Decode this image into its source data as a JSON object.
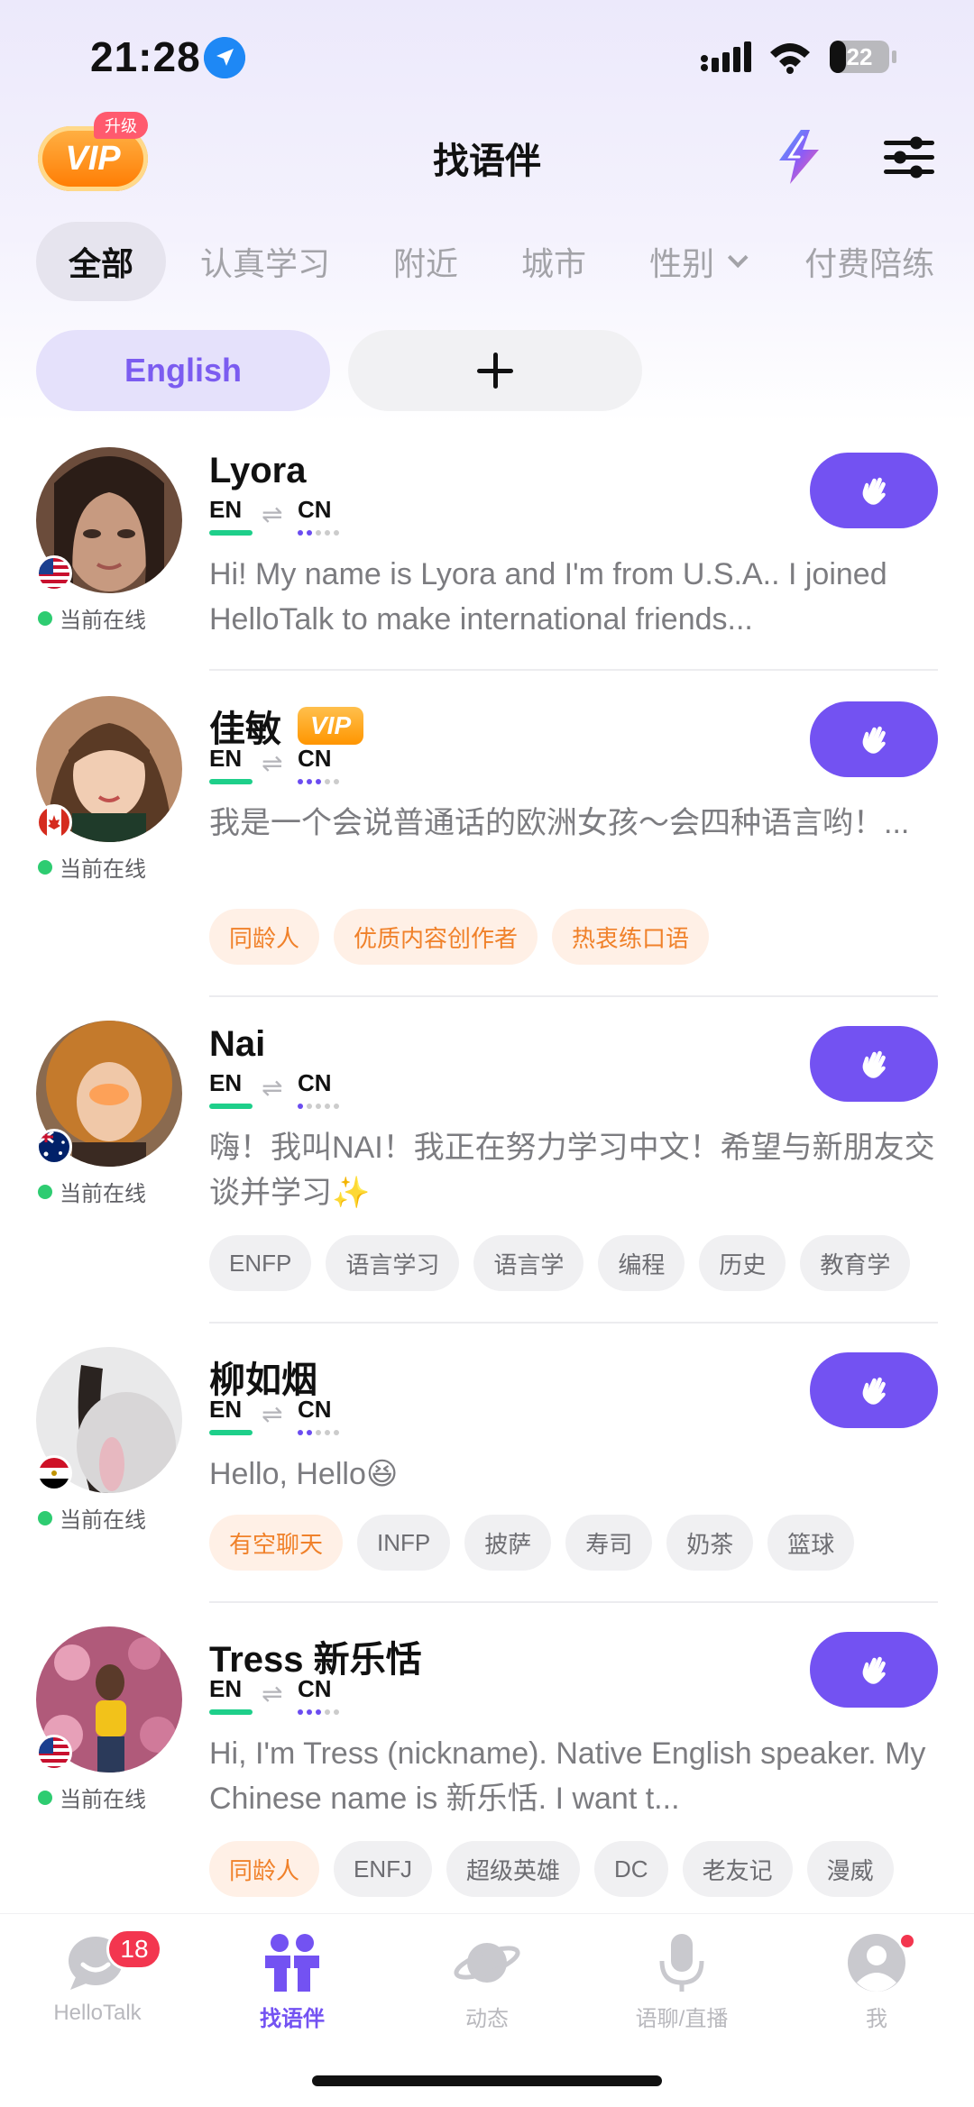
{
  "status_bar": {
    "time": "21:28",
    "battery": "22"
  },
  "header": {
    "title": "找语伴",
    "vip_label": "VIP",
    "upgrade_label": "升级"
  },
  "category_tabs": [
    {
      "label": "全部",
      "active": true
    },
    {
      "label": "认真学习"
    },
    {
      "label": "附近"
    },
    {
      "label": "城市"
    },
    {
      "label": "性别",
      "dropdown": true
    },
    {
      "label": "付费陪练"
    }
  ],
  "language_filter": {
    "selected": "English",
    "add_symbol": "+"
  },
  "users": [
    {
      "name": "Lyora",
      "vip": false,
      "native": "EN",
      "learning": "CN",
      "learning_level": 2,
      "flag": "us-flag",
      "status": "当前在线",
      "bio": "Hi! My name is Lyora and I'm from U.S.A.. I joined HelloTalk to make international friends...",
      "tags": []
    },
    {
      "name": "佳敏",
      "vip": true,
      "vip_label": "VIP",
      "native": "EN",
      "learning": "CN",
      "learning_level": 3,
      "flag": "ca-flag",
      "status": "当前在线",
      "bio": "我是一个会说普通话的欧洲女孩～会四种语言哟！...",
      "tags": [
        {
          "label": "同龄人",
          "highlight": true
        },
        {
          "label": "优质内容创作者",
          "highlight": true
        },
        {
          "label": "热衷练口语",
          "highlight": true
        }
      ]
    },
    {
      "name": "Nai",
      "vip": false,
      "native": "EN",
      "learning": "CN",
      "learning_level": 1,
      "flag": "au-flag",
      "status": "当前在线",
      "bio": "嗨！我叫NAI！我正在努力学习中文！希望与新朋友交谈并学习✨",
      "tags": [
        {
          "label": "ENFP"
        },
        {
          "label": "语言学习"
        },
        {
          "label": "语言学"
        },
        {
          "label": "编程"
        },
        {
          "label": "历史"
        },
        {
          "label": "教育学"
        }
      ]
    },
    {
      "name": "柳如烟",
      "vip": false,
      "native": "EN",
      "learning": "CN",
      "learning_level": 2,
      "flag": "eg-flag",
      "status": "当前在线",
      "bio": "Hello, Hello😆",
      "tags": [
        {
          "label": "有空聊天",
          "highlight": true
        },
        {
          "label": "INFP"
        },
        {
          "label": "披萨"
        },
        {
          "label": "寿司"
        },
        {
          "label": "奶茶"
        },
        {
          "label": "篮球"
        }
      ]
    },
    {
      "name": "Tress 新乐恬",
      "vip": false,
      "native": "EN",
      "learning": "CN",
      "learning_level": 3,
      "flag": "us-flag",
      "status": "当前在线",
      "bio": "Hi, I'm Tress (nickname). Native English speaker. My Chinese name is 新乐恬. I want t...",
      "tags": [
        {
          "label": "同龄人",
          "highlight": true
        },
        {
          "label": "ENFJ"
        },
        {
          "label": "超级英雄"
        },
        {
          "label": "DC"
        },
        {
          "label": "老友记"
        },
        {
          "label": "漫威"
        }
      ]
    }
  ],
  "bottom_nav": [
    {
      "label": "HelloTalk",
      "icon": "chat-bubble-icon",
      "badge": "18"
    },
    {
      "label": "找语伴",
      "icon": "partners-icon",
      "active": true
    },
    {
      "label": "动态",
      "icon": "planet-icon"
    },
    {
      "label": "语聊/直播",
      "icon": "microphone-icon"
    },
    {
      "label": "我",
      "icon": "profile-icon",
      "dot": true
    }
  ],
  "colors": {
    "accent": "#7352f2",
    "online": "#2ecc71",
    "native_bar": "#1ecf8a",
    "tag_highlight": "#f0812a",
    "badge": "#f3364f",
    "vip": "#ff9500"
  }
}
